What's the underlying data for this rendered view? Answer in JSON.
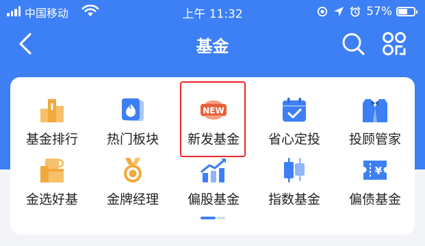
{
  "status_bar": {
    "carrier": "中国移动",
    "time": "上午 11:32",
    "battery": "57%",
    "battery_level": 0.57,
    "icons": [
      "signal-icon",
      "wifi-icon",
      "screen-record-icon",
      "location-arrow-icon",
      "alarm-icon",
      "battery-icon"
    ]
  },
  "nav": {
    "title": "基金",
    "back_icon": "chevron-left-icon",
    "search_icon": "search-icon",
    "scan_icon": "grid-scan-icon"
  },
  "grid": {
    "rows": [
      [
        {
          "label": "基金排行",
          "icon": "ranking-podium-icon"
        },
        {
          "label": "热门板块",
          "icon": "fire-cards-icon"
        },
        {
          "label": "新发基金",
          "icon": "new-badge-icon"
        },
        {
          "label": "省心定投",
          "icon": "calendar-check-icon"
        },
        {
          "label": "投顾管家",
          "icon": "butler-suit-icon"
        }
      ],
      [
        {
          "label": "金选好基",
          "icon": "trophy-cup-icon"
        },
        {
          "label": "金牌经理",
          "icon": "gold-medal-icon"
        },
        {
          "label": "偏股基金",
          "icon": "bar-chart-rising-icon"
        },
        {
          "label": "指数基金",
          "icon": "candlestick-icon"
        },
        {
          "label": "偏债基金",
          "icon": "bond-ticket-icon"
        }
      ]
    ],
    "new_badge_text": "NEW",
    "ticket_symbol": "¥"
  },
  "pager": {
    "current": 1,
    "total": 2
  },
  "colors": {
    "brand_blue": "#3d7ff5",
    "icon_blue": "#3d7ff5",
    "icon_orange": "#f2a93b",
    "icon_red": "#e8603c",
    "highlight_red": "#e8252a",
    "background": "#f2f4f8"
  }
}
